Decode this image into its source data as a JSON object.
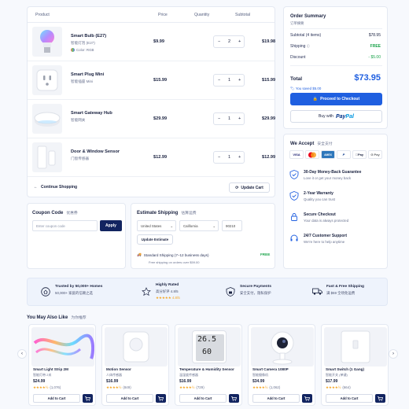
{
  "cart": {
    "headers": {
      "product": "Product",
      "price": "Price",
      "quantity": "Quantity",
      "subtotal": "Subtotal"
    },
    "items": [
      {
        "name": "Smart Bulb (E27)",
        "cn": "智能灯泡 (E27)",
        "meta": "Color: RGB",
        "price": "$9.99",
        "qty": "2",
        "subtotal": "$19.98"
      },
      {
        "name": "Smart Plug Mini",
        "cn": "智能插座 Mini",
        "meta": "",
        "price": "$15.99",
        "qty": "1",
        "subtotal": "$15.99"
      },
      {
        "name": "Smart Gateway Hub",
        "cn": "智能网关",
        "meta": "",
        "price": "$29.99",
        "qty": "1",
        "subtotal": "$29.99"
      },
      {
        "name": "Door & Window Sensor",
        "cn": "门窗传感器",
        "meta": "",
        "price": "$12.99",
        "qty": "1",
        "subtotal": "$12.99"
      }
    ],
    "continue_label": "Continue Shopping",
    "update_label": "Update Cart"
  },
  "coupon": {
    "title": "Coupon Code",
    "title_cn": "优惠券",
    "placeholder": "Enter coupon code",
    "apply": "Apply"
  },
  "shipping": {
    "title": "Estimate Shipping",
    "title_cn": "估算运费",
    "country": "United States",
    "state": "California",
    "zip": "90210",
    "update": "Update Estimate",
    "method": "Standard Shipping (7–12 business days)",
    "method_price": "FREE",
    "free_note": "Free shipping on orders over $59.00"
  },
  "summary": {
    "title": "Order Summary",
    "title_cn": "订单摘要",
    "subtotal_label": "Subtotal (4 items)",
    "subtotal": "$78.95",
    "shipping_label": "Shipping",
    "shipping": "FREE",
    "discount_label": "Discount",
    "discount": "- $5.00",
    "total_label": "Total",
    "total": "$73.95",
    "saved": "You saved $5.00",
    "checkout": "Proceed to Checkout",
    "buy_with": "Buy with",
    "paypal_a": "Pay",
    "paypal_b": "Pal"
  },
  "accept": {
    "title": "We Accept",
    "title_cn": "安全支付",
    "methods": [
      "VISA",
      "MC",
      "AMEX",
      "P",
      "Pay",
      "G Pay"
    ],
    "items": [
      {
        "title": "30-Day Money-Back Guarantee",
        "sub": "Love it or get your money back"
      },
      {
        "title": "2-Year Warranty",
        "sub": "Quality you can trust"
      },
      {
        "title": "Secure Checkout",
        "sub": "Your data is always protected"
      },
      {
        "title": "24/7 Customer Support",
        "sub": "We're here to help anytime"
      }
    ]
  },
  "trust": [
    {
      "title": "Trusted by 50,000+ Homes",
      "sub": "50,000+ 家庭的信赖之选"
    },
    {
      "title": "Highly Rated",
      "sub": "高分好评 4.8/5",
      "extra": "★★★★★ 4.8/5"
    },
    {
      "title": "Secure Payments",
      "sub": "安全支付，隐私保护"
    },
    {
      "title": "Fast & Free Shipping",
      "sub": "满 $59 全场免运费"
    }
  ],
  "recs": {
    "title": "You May Also Like",
    "title_cn": "为你推荐",
    "items": [
      {
        "name": "Smart Light Strip 2M",
        "cn": "智能灯带 2米",
        "price": "$24.99",
        "stars": "★★★★½",
        "count": "(1,076)",
        "add": "Add to Cart"
      },
      {
        "name": "Motion Sensor",
        "cn": "人体传感器",
        "price": "$16.99",
        "stars": "★★★★½",
        "count": "(849)",
        "add": "Add to Cart"
      },
      {
        "name": "Temperature & Humidity Sensor",
        "cn": "温湿度传感器",
        "price": "$16.99",
        "stars": "★★★★½",
        "count": "(729)",
        "add": "Add to Cart"
      },
      {
        "name": "Smart Camera 1080P",
        "cn": "智能摄像机",
        "price": "$34.99",
        "stars": "★★★★½",
        "count": "(1,062)",
        "add": "Add to Cart"
      },
      {
        "name": "Smart Switch (1 Gang)",
        "cn": "智能开关 (单键)",
        "price": "$17.99",
        "stars": "★★★★½",
        "count": "(664)",
        "add": "Add to Cart"
      }
    ],
    "thermo_top": "26.5",
    "thermo_bottom": "60"
  },
  "colors": {
    "primary": "#1f5fe0",
    "navy": "#122460",
    "green": "#1aa34a"
  }
}
